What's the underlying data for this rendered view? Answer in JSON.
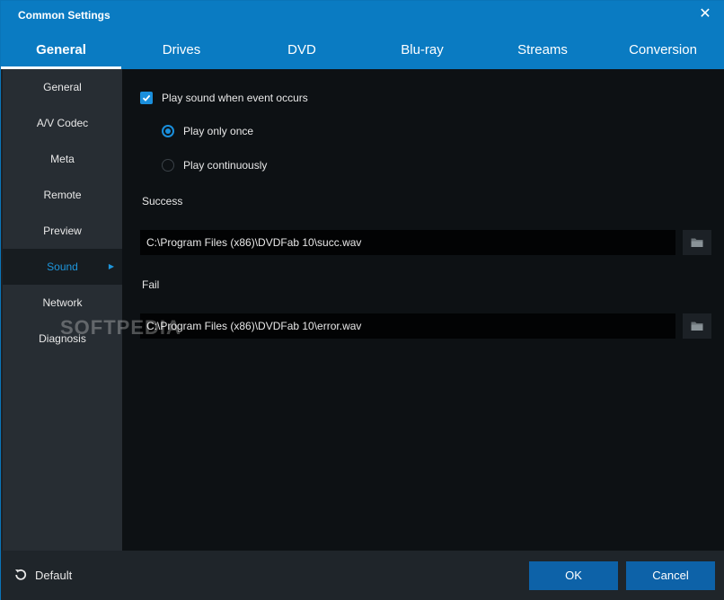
{
  "window": {
    "title": "Common Settings",
    "close_glyph": "✕"
  },
  "tabs": [
    {
      "label": "General",
      "active": true
    },
    {
      "label": "Drives"
    },
    {
      "label": "DVD"
    },
    {
      "label": "Blu-ray"
    },
    {
      "label": "Streams"
    },
    {
      "label": "Conversion"
    }
  ],
  "sidebar": {
    "items": [
      {
        "label": "General"
      },
      {
        "label": "A/V Codec"
      },
      {
        "label": "Meta"
      },
      {
        "label": "Remote"
      },
      {
        "label": "Preview"
      },
      {
        "label": "Sound",
        "active": true
      },
      {
        "label": "Network"
      },
      {
        "label": "Diagnosis"
      }
    ]
  },
  "sound": {
    "play_sound_label": "Play sound when event occurs",
    "play_sound_checked": true,
    "play_once_label": "Play only once",
    "play_continuously_label": "Play continuously",
    "selected_mode": "once",
    "success_label": "Success",
    "success_path": "C:\\Program Files (x86)\\DVDFab 10\\succ.wav",
    "fail_label": "Fail",
    "fail_path": "C:\\Program Files (x86)\\DVDFab 10\\error.wav"
  },
  "footer": {
    "default_label": "Default",
    "ok_label": "OK",
    "cancel_label": "Cancel"
  },
  "watermark": "SOFTPEDIA",
  "colors": {
    "accent": "#1a8fdc",
    "header": "#0a7bc2",
    "button": "#0d62a8",
    "sidebar": "#272d33",
    "content": "#0d1114"
  },
  "icons": {
    "browse": "folder-icon",
    "default": "reset-icon",
    "checkbox": "check-icon"
  }
}
